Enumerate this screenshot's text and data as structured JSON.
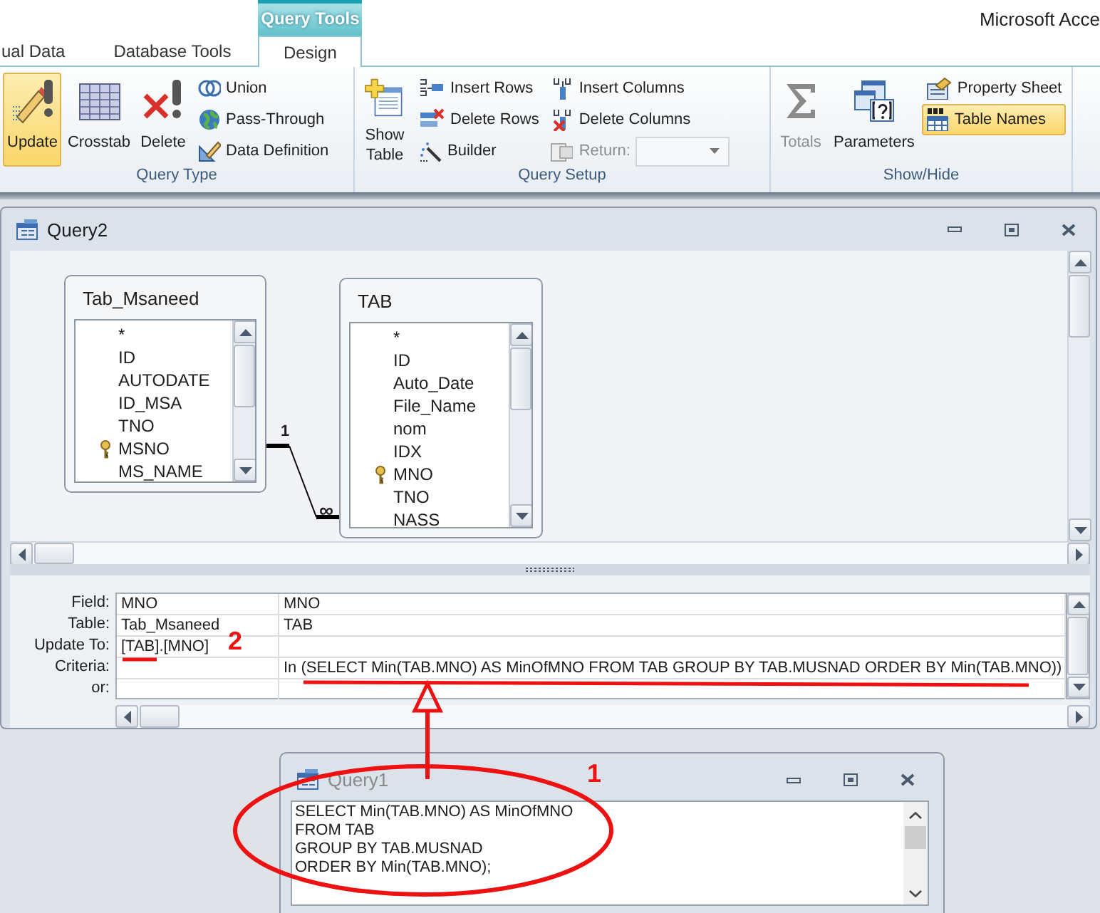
{
  "app_title": "Microsoft Acce",
  "contextual_tab_group": {
    "label": "Query Tools"
  },
  "ribbon_tabs": [
    {
      "label": "ual Data",
      "selected": false,
      "contextual": false
    },
    {
      "label": "Database Tools",
      "selected": false,
      "contextual": false
    },
    {
      "label": "Design",
      "selected": true,
      "contextual": true
    }
  ],
  "ribbon_groups": [
    {
      "label": "Query Type",
      "items": [
        {
          "kind": "large",
          "label": "Update",
          "selected": true,
          "disabled": false
        },
        {
          "kind": "large",
          "label": "Crosstab",
          "selected": false,
          "disabled": false
        },
        {
          "kind": "large",
          "label": "Delete",
          "selected": false,
          "disabled": false
        },
        {
          "kind": "small",
          "label": "Union",
          "selected": false,
          "disabled": false
        },
        {
          "kind": "small",
          "label": "Pass-Through",
          "selected": false,
          "disabled": false
        },
        {
          "kind": "small",
          "label": "Data Definition",
          "selected": false,
          "disabled": false
        }
      ]
    },
    {
      "label": "Query Setup",
      "items": [
        {
          "kind": "large",
          "label": "Show Table",
          "selected": false,
          "disabled": false
        },
        {
          "kind": "small",
          "label": "Insert Rows",
          "selected": false,
          "disabled": false
        },
        {
          "kind": "small",
          "label": "Delete Rows",
          "selected": false,
          "disabled": false
        },
        {
          "kind": "small",
          "label": "Builder",
          "selected": false,
          "disabled": false
        },
        {
          "kind": "small",
          "label": "Insert Columns",
          "selected": false,
          "disabled": false
        },
        {
          "kind": "small",
          "label": "Delete Columns",
          "selected": false,
          "disabled": false
        },
        {
          "kind": "dropdown",
          "label": "Return:",
          "disabled": true
        }
      ]
    },
    {
      "label": "Show/Hide",
      "items": [
        {
          "kind": "large",
          "label": "Totals",
          "selected": false,
          "disabled": true
        },
        {
          "kind": "large",
          "label": "Parameters",
          "selected": false,
          "disabled": false
        },
        {
          "kind": "small",
          "label": "Property Sheet",
          "selected": false,
          "disabled": false
        },
        {
          "kind": "small",
          "label": "Table Names",
          "selected": true,
          "disabled": false
        }
      ]
    }
  ],
  "design_window": {
    "title": "Query2",
    "tables": [
      {
        "name": "Tab_Msaneed",
        "fields": [
          {
            "name": "*",
            "primary_key": false
          },
          {
            "name": "ID",
            "primary_key": false
          },
          {
            "name": "AUTODATE",
            "primary_key": false
          },
          {
            "name": "ID_MSA",
            "primary_key": false
          },
          {
            "name": "TNO",
            "primary_key": false
          },
          {
            "name": "MSNO",
            "primary_key": true
          },
          {
            "name": "MS_NAME",
            "primary_key": false
          }
        ]
      },
      {
        "name": "TAB",
        "fields": [
          {
            "name": "*",
            "primary_key": false
          },
          {
            "name": "ID",
            "primary_key": false
          },
          {
            "name": "Auto_Date",
            "primary_key": false
          },
          {
            "name": "File_Name",
            "primary_key": false
          },
          {
            "name": "nom",
            "primary_key": false
          },
          {
            "name": "IDX",
            "primary_key": false
          },
          {
            "name": "MNO",
            "primary_key": true
          },
          {
            "name": "TNO",
            "primary_key": false
          },
          {
            "name": "NASS",
            "primary_key": false
          }
        ]
      }
    ],
    "relationship": {
      "one_label": "1",
      "many_label": "∞"
    },
    "grid": {
      "rows": [
        {
          "label": "Field:",
          "column_1": "MNO",
          "column_2": "MNO"
        },
        {
          "label": "Table:",
          "column_1": "Tab_Msaneed",
          "column_2": "TAB"
        },
        {
          "label": "Update To:",
          "column_1": "[TAB].[MNO]"
        },
        {
          "label": "Criteria:",
          "column_2": "In (SELECT Min(TAB.MNO) AS MinOfMNO FROM TAB GROUP BY TAB.MUSNAD ORDER BY Min(TAB.MNO))"
        },
        {
          "label": "or:"
        }
      ]
    }
  },
  "sql_window": {
    "title": "Query1",
    "lines": [
      "SELECT Min(TAB.MNO) AS MinOfMNO",
      "FROM TAB",
      "GROUP BY TAB.MUSNAD",
      "ORDER BY Min(TAB.MNO);"
    ]
  },
  "annotations": [
    {
      "kind": "ellipse"
    },
    {
      "kind": "arrow"
    },
    {
      "kind": "underline"
    },
    {
      "kind": "underline"
    },
    {
      "kind": "label",
      "text": "1"
    },
    {
      "kind": "label",
      "text": "2"
    }
  ]
}
